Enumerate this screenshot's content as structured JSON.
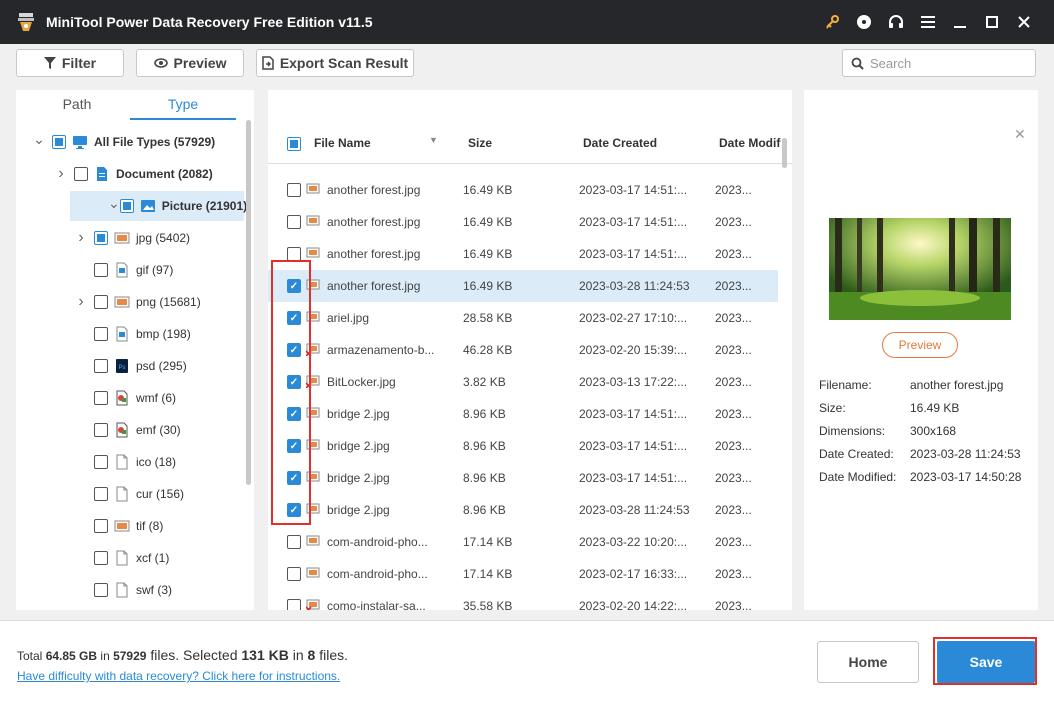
{
  "window": {
    "title": "MiniTool Power Data Recovery Free Edition v11.5"
  },
  "toolbar": {
    "filter_label": "Filter",
    "preview_label": "Preview",
    "export_label": "Export Scan Result",
    "search_placeholder": "Search"
  },
  "tabs": {
    "path": "Path",
    "type": "Type"
  },
  "tree": [
    {
      "label": "All File Types (57929)",
      "level": 0,
      "expanded": true,
      "state": "partial",
      "icon": "computer-icon",
      "bold": true
    },
    {
      "label": "Document (2082)",
      "level": 1,
      "expanded": false,
      "state": "unchecked",
      "icon": "document-icon",
      "bold": true
    },
    {
      "label": "Picture (21901)",
      "level": 1,
      "expanded": true,
      "state": "partial",
      "icon": "picture-icon",
      "bold": true,
      "selected": true
    },
    {
      "label": "jpg (5402)",
      "level": 2,
      "expanded": false,
      "state": "partial",
      "icon": "jpg-icon"
    },
    {
      "label": "gif (97)",
      "level": 2,
      "state": "unchecked",
      "icon": "gif-icon"
    },
    {
      "label": "png (15681)",
      "level": 2,
      "expanded": false,
      "state": "unchecked",
      "icon": "png-icon"
    },
    {
      "label": "bmp (198)",
      "level": 2,
      "state": "unchecked",
      "icon": "bmp-icon"
    },
    {
      "label": "psd (295)",
      "level": 2,
      "state": "unchecked",
      "icon": "psd-icon"
    },
    {
      "label": "wmf (6)",
      "level": 2,
      "state": "unchecked",
      "icon": "wmf-icon"
    },
    {
      "label": "emf (30)",
      "level": 2,
      "state": "unchecked",
      "icon": "emf-icon"
    },
    {
      "label": "ico (18)",
      "level": 2,
      "state": "unchecked",
      "icon": "blank-file-icon"
    },
    {
      "label": "cur (156)",
      "level": 2,
      "state": "unchecked",
      "icon": "blank-file-icon"
    },
    {
      "label": "tif (8)",
      "level": 2,
      "state": "unchecked",
      "icon": "tif-icon"
    },
    {
      "label": "xcf (1)",
      "level": 2,
      "state": "unchecked",
      "icon": "blank-file-icon"
    },
    {
      "label": "swf (3)",
      "level": 2,
      "state": "unchecked",
      "icon": "blank-file-icon"
    }
  ],
  "table": {
    "headers": {
      "name": "File Name",
      "size": "Size",
      "created": "Date Created",
      "modified": "Date Modif"
    },
    "rows": [
      {
        "name": "another forest.jpg",
        "size": "16.49 KB",
        "created": "2023-03-17 14:51:...",
        "modified": "2023...",
        "checked": false,
        "deleted": false
      },
      {
        "name": "another forest.jpg",
        "size": "16.49 KB",
        "created": "2023-03-17 14:51:...",
        "modified": "2023...",
        "checked": false,
        "deleted": false
      },
      {
        "name": "another forest.jpg",
        "size": "16.49 KB",
        "created": "2023-03-17 14:51:...",
        "modified": "2023...",
        "checked": false,
        "deleted": false
      },
      {
        "name": "another forest.jpg",
        "size": "16.49 KB",
        "created": "2023-03-28 11:24:53",
        "modified": "2023...",
        "checked": true,
        "deleted": false,
        "selected": true
      },
      {
        "name": "ariel.jpg",
        "size": "28.58 KB",
        "created": "2023-02-27 17:10:...",
        "modified": "2023...",
        "checked": true,
        "deleted": false
      },
      {
        "name": "armazenamento-b...",
        "size": "46.28 KB",
        "created": "2023-02-20 15:39:...",
        "modified": "2023...",
        "checked": true,
        "deleted": true
      },
      {
        "name": "BitLocker.jpg",
        "size": "3.82 KB",
        "created": "2023-03-13 17:22:...",
        "modified": "2023...",
        "checked": true,
        "deleted": true
      },
      {
        "name": "bridge 2.jpg",
        "size": "8.96 KB",
        "created": "2023-03-17 14:51:...",
        "modified": "2023...",
        "checked": true,
        "deleted": false
      },
      {
        "name": "bridge 2.jpg",
        "size": "8.96 KB",
        "created": "2023-03-17 14:51:...",
        "modified": "2023...",
        "checked": true,
        "deleted": false
      },
      {
        "name": "bridge 2.jpg",
        "size": "8.96 KB",
        "created": "2023-03-17 14:51:...",
        "modified": "2023...",
        "checked": true,
        "deleted": false
      },
      {
        "name": "bridge 2.jpg",
        "size": "8.96 KB",
        "created": "2023-03-28 11:24:53",
        "modified": "2023...",
        "checked": true,
        "deleted": false
      },
      {
        "name": "com-android-pho...",
        "size": "17.14 KB",
        "created": "2023-03-22 10:20:...",
        "modified": "2023...",
        "checked": false,
        "deleted": false
      },
      {
        "name": "com-android-pho...",
        "size": "17.14 KB",
        "created": "2023-02-17 16:33:...",
        "modified": "2023...",
        "checked": false,
        "deleted": false
      },
      {
        "name": "como-instalar-sa...",
        "size": "35.58 KB",
        "created": "2023-02-20 14:22:...",
        "modified": "2023...",
        "checked": false,
        "deleted": true
      }
    ]
  },
  "preview": {
    "button_label": "Preview",
    "info": [
      {
        "key": "Filename:",
        "value": "another forest.jpg"
      },
      {
        "key": "Size:",
        "value": "16.49 KB"
      },
      {
        "key": "Dimensions:",
        "value": "300x168"
      },
      {
        "key": "Date Created:",
        "value": "2023-03-28 11:24:53"
      },
      {
        "key": "Date Modified:",
        "value": "2023-03-17 14:50:28"
      }
    ]
  },
  "footer": {
    "total_prefix": "Total ",
    "total_size": "64.85 GB",
    "in1": " in ",
    "total_files": "57929",
    "files1": " files.  Selected ",
    "selected_size": "131 KB",
    "in2": " in ",
    "selected_files": "8",
    "files2": " files.",
    "help_link": "Have difficulty with data recovery? Click here for instructions.",
    "home_label": "Home",
    "save_label": "Save"
  },
  "colors": {
    "accent": "#2b8ad8",
    "highlight": "#e0302b",
    "titlebar": "#25272b",
    "preview_button": "#e07a3a"
  }
}
